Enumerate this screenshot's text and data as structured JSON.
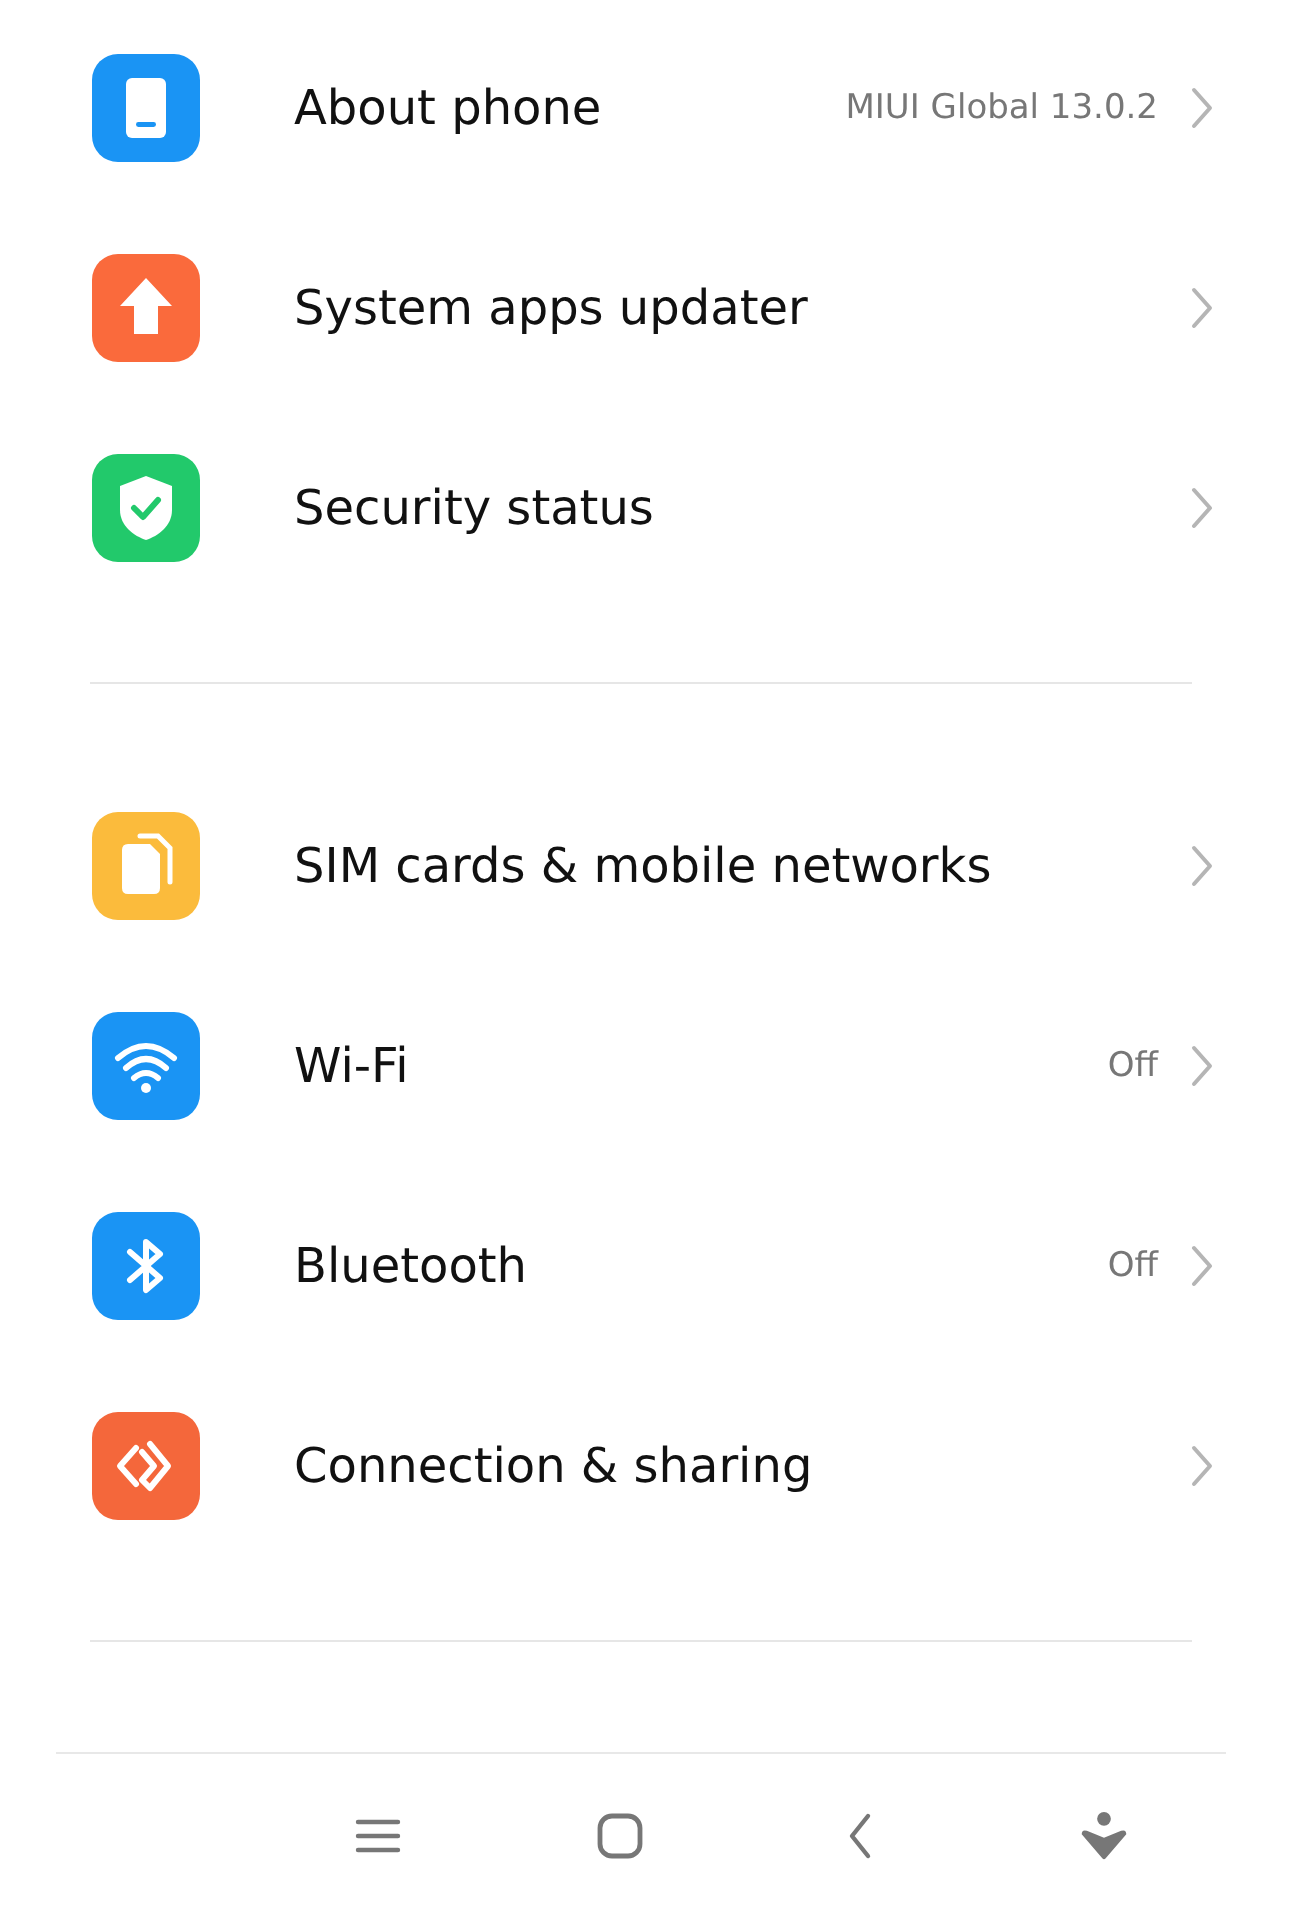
{
  "sections": [
    {
      "items": [
        {
          "kind": "phone",
          "color": "#1a94f4",
          "label": "About phone",
          "value": "MIUI Global 13.0.2"
        },
        {
          "kind": "update",
          "color": "#fa6a3c",
          "label": "System apps updater"
        },
        {
          "kind": "shield",
          "color": "#22c96b",
          "label": "Security status"
        }
      ]
    },
    {
      "items": [
        {
          "kind": "sim",
          "color": "#fbbb3c",
          "label": "SIM cards & mobile networks"
        },
        {
          "kind": "wifi",
          "color": "#1a94f4",
          "label": "Wi-Fi",
          "value": "Off"
        },
        {
          "kind": "bluetooth",
          "color": "#1a94f4",
          "label": "Bluetooth",
          "value": "Off"
        },
        {
          "kind": "share",
          "color": "#f4673b",
          "label": "Connection & sharing"
        }
      ]
    }
  ],
  "nav": [
    {
      "kind": "menu"
    },
    {
      "kind": "home"
    },
    {
      "kind": "back"
    },
    {
      "kind": "assistant"
    }
  ]
}
